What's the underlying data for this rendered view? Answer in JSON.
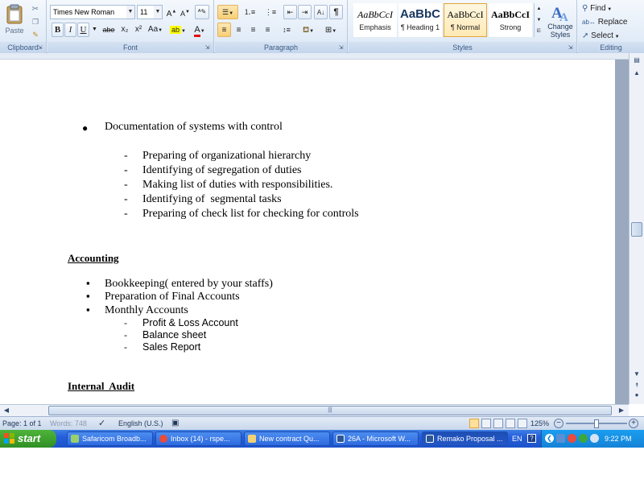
{
  "ribbon": {
    "clipboard": {
      "group_label": "Clipboard",
      "paste_label": "Paste"
    },
    "font": {
      "group_label": "Font",
      "font_name": "Times New Roman",
      "font_size": "11",
      "bold": "B",
      "italic": "I",
      "underline": "U",
      "strike": "abe",
      "subscript": "x₂",
      "superscript": "x²",
      "change_case": "Aa"
    },
    "paragraph": {
      "group_label": "Paragraph"
    },
    "styles": {
      "group_label": "Styles",
      "items": [
        {
          "sample": "AaBbCcI",
          "name": "Emphasis"
        },
        {
          "sample": "AaBbC",
          "name": "¶ Heading 1"
        },
        {
          "sample": "AaBbCcI",
          "name": "¶ Normal"
        },
        {
          "sample": "AaBbCcI",
          "name": "Strong"
        }
      ],
      "change_styles_line1": "Change",
      "change_styles_line2": "Styles"
    },
    "editing": {
      "group_label": "Editing",
      "find": "Find",
      "replace": "Replace",
      "select": "Select"
    }
  },
  "document": {
    "bullet_top": "Documentation of systems with control",
    "dash_items": [
      "Preparing of organizational hierarchy",
      "Identifying of segregation of duties",
      "Making list of duties with responsibilities.",
      "Identifying of  segmental tasks",
      "Preparing of check list for checking for controls"
    ],
    "heading_accounting": "Accounting",
    "square_items": [
      "Bookkeeping( entered by your staffs)",
      "Preparation of Final Accounts",
      "Monthly Accounts"
    ],
    "sub_items": [
      "Profit & Loss Account",
      "Balance sheet",
      "Sales Report"
    ],
    "heading_internal_audit": "Internal  Audit",
    "bullet_glyph": "●",
    "dash_glyph": "-",
    "square_glyph": "▪"
  },
  "statusbar": {
    "page": "Page: 1 of 1",
    "words": "Words: 748",
    "language": "English (U.S.)",
    "zoom": "125%"
  },
  "taskbar": {
    "start": "start",
    "tasks": [
      "Safaricom Broadb...",
      "Inbox (14) - rspe...",
      "New contract Qu...",
      "26A - Microsoft W...",
      "Remako Proposal ..."
    ],
    "language": "EN",
    "time": "9:22 PM"
  },
  "colors": {
    "ribbon_bg": "#dbe7f5",
    "taskbar": "#245edb",
    "start_green": "#2f8f25",
    "tray_blue": "#1482d6",
    "selected_style": "#ffe9b4"
  }
}
